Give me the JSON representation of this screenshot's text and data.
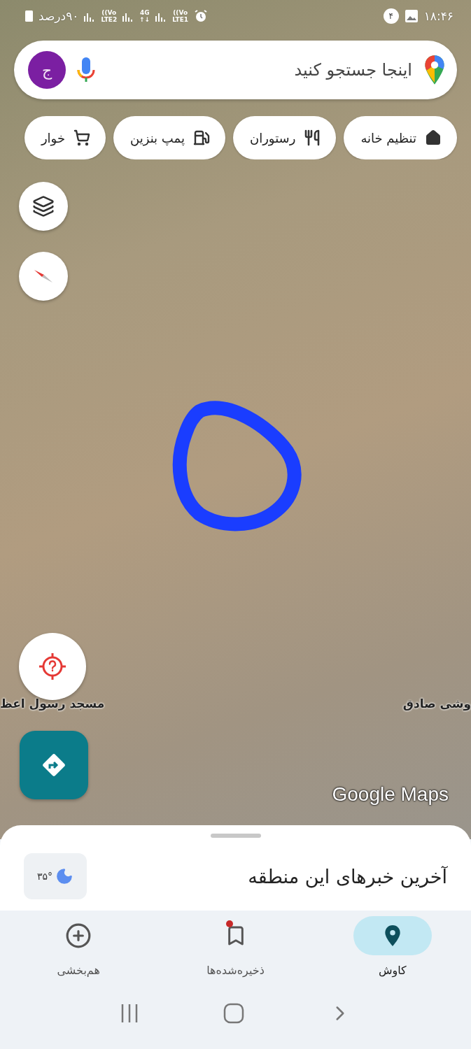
{
  "status_bar": {
    "time": "۱۸:۴۶",
    "notification_count": "۴",
    "battery": "۹۰درصد",
    "indicators": [
      {
        "top": "Vo))",
        "bottom": "LTE1"
      },
      {
        "top": "4G",
        "bottom": "↓↑"
      },
      {
        "top": "Vo))",
        "bottom": "LTE2"
      }
    ]
  },
  "search": {
    "placeholder": "اینجا جستجو کنید",
    "avatar_letter": "ج"
  },
  "chips": [
    {
      "label": "تنظیم خانه",
      "kind": "home"
    },
    {
      "label": "رستوران",
      "kind": "restaurant"
    },
    {
      "label": "پمپ بنزین",
      "kind": "gas"
    },
    {
      "label": "خوار",
      "kind": "shopping"
    }
  ],
  "map": {
    "labels": [
      "وشی صادق",
      "مسجد رسول اعظ"
    ],
    "logo": "Google Maps"
  },
  "sheet": {
    "title": "آخرین خبرهای این منطقه",
    "temperature": "۳۵°"
  },
  "nav_tabs": [
    {
      "label": "کاوش",
      "kind": "explore",
      "selected": true,
      "badge": false
    },
    {
      "label": "ذخیره‌شده‌ها",
      "kind": "saved",
      "selected": false,
      "badge": true
    },
    {
      "label": "هم‌بخشی",
      "kind": "contribute",
      "selected": false,
      "badge": false
    }
  ]
}
